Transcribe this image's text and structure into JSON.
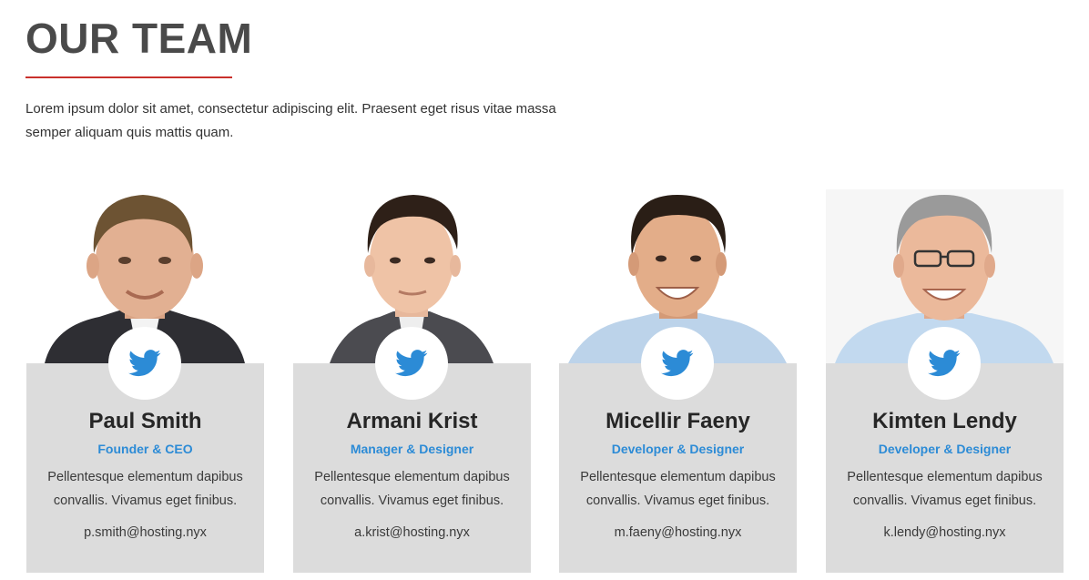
{
  "section": {
    "title": "OUR TEAM",
    "intro": "Lorem ipsum dolor sit amet, consectetur adipiscing elit. Praesent eget risus vitae massa semper aliquam quis mattis quam."
  },
  "colors": {
    "accent_red": "#c9302c",
    "role_blue": "#2c8bd6",
    "card_bg": "#dcdcdc",
    "twitter_blue": "#2c8bd6"
  },
  "team": [
    {
      "name": "Paul Smith",
      "role": "Founder & CEO",
      "bio": "Pellentesque elementum dapibus convallis. Vivamus eget finibus.",
      "email": "p.smith@hosting.nyx",
      "social_icon": "twitter-icon"
    },
    {
      "name": "Armani Krist",
      "role": "Manager & Designer",
      "bio": "Pellentesque elementum dapibus convallis. Vivamus eget finibus.",
      "email": "a.krist@hosting.nyx",
      "social_icon": "twitter-icon"
    },
    {
      "name": "Micellir Faeny",
      "role": "Developer & Designer",
      "bio": "Pellentesque elementum dapibus convallis. Vivamus eget finibus.",
      "email": "m.faeny@hosting.nyx",
      "social_icon": "twitter-icon"
    },
    {
      "name": "Kimten Lendy",
      "role": "Developer & Designer",
      "bio": "Pellentesque elementum dapibus convallis. Vivamus eget finibus.",
      "email": "k.lendy@hosting.nyx",
      "social_icon": "twitter-icon"
    }
  ]
}
